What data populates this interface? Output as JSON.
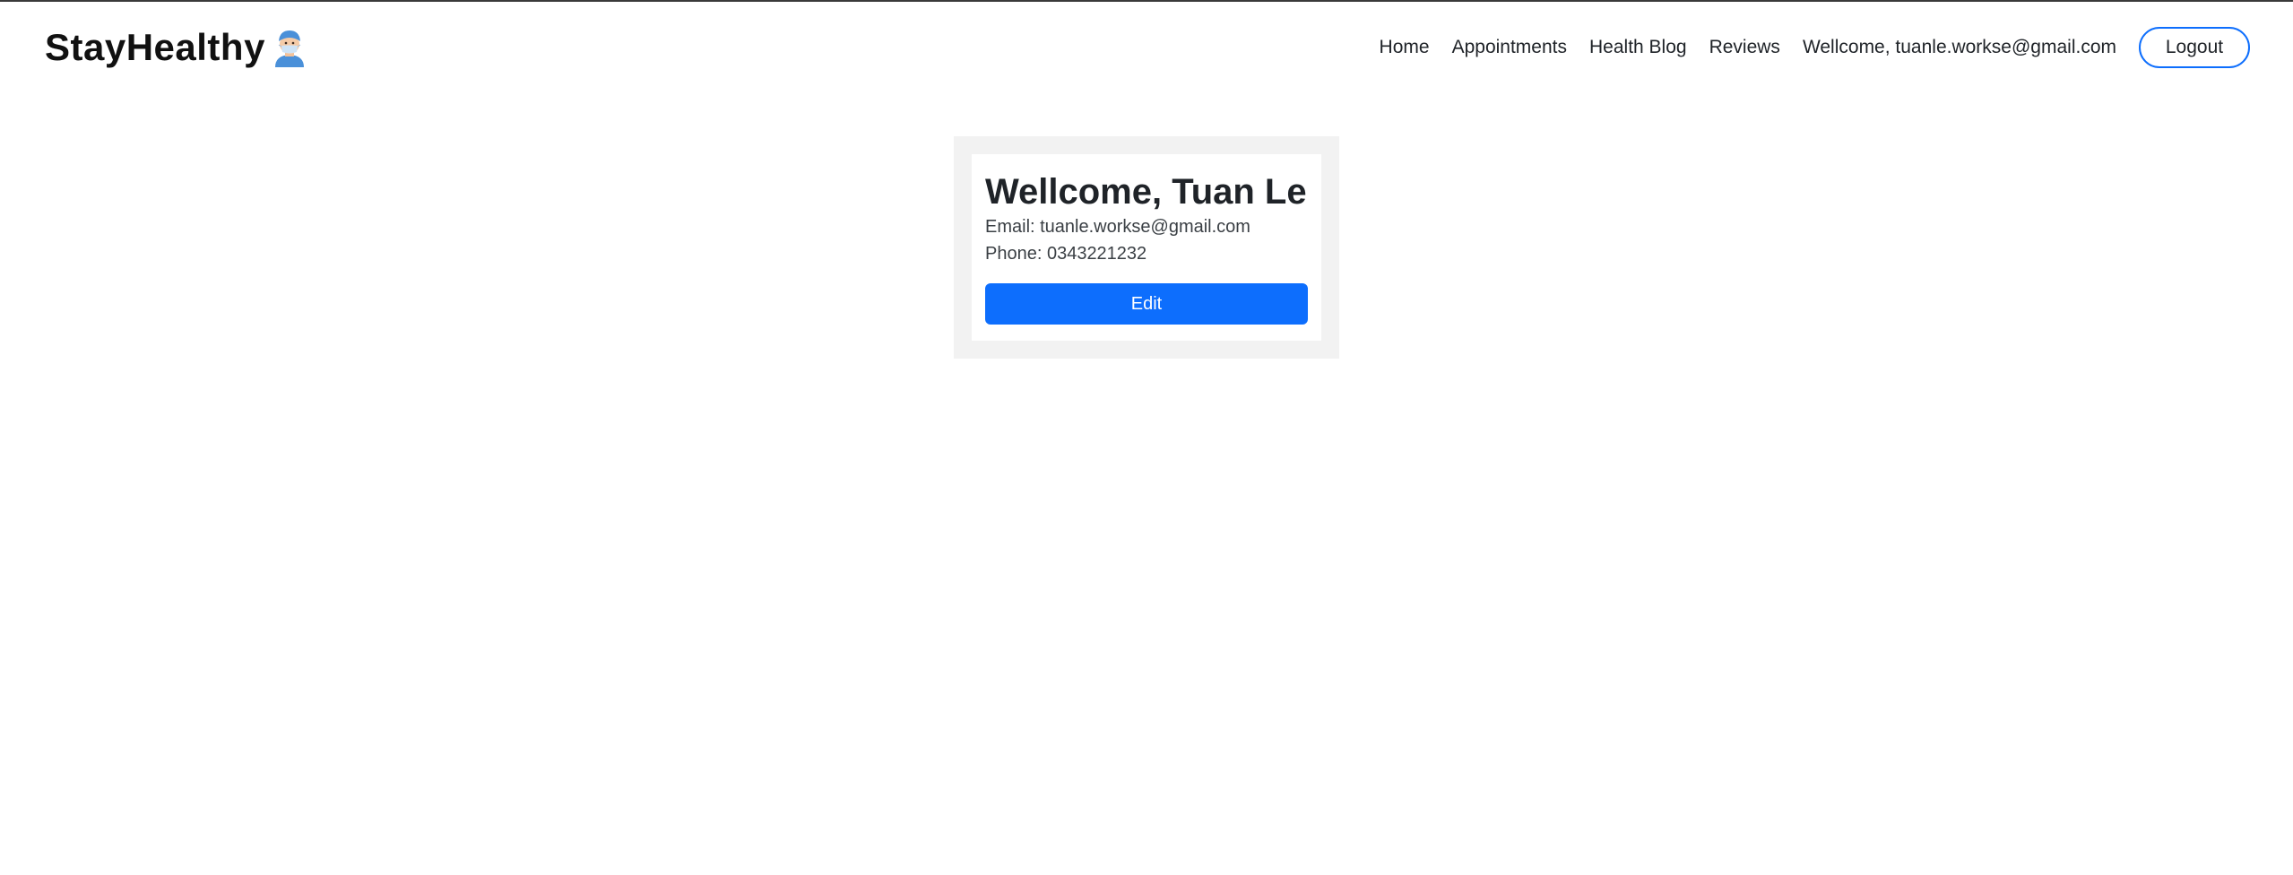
{
  "navbar": {
    "brand": "StayHealthy",
    "brand_icon": "doctor-emoji-icon",
    "links": [
      {
        "label": "Home"
      },
      {
        "label": "Appointments"
      },
      {
        "label": "Health Blog"
      },
      {
        "label": "Reviews"
      }
    ],
    "user_greeting": "Wellcome, tuanle.workse@gmail.com",
    "logout_label": "Logout"
  },
  "profile": {
    "title": "Wellcome, Tuan Le",
    "email_line": "Email: tuanle.workse@gmail.com",
    "phone_line": "Phone: 0343221232",
    "edit_label": "Edit"
  },
  "colors": {
    "accent": "#0d6efd",
    "card_background": "#f2f2f2"
  }
}
